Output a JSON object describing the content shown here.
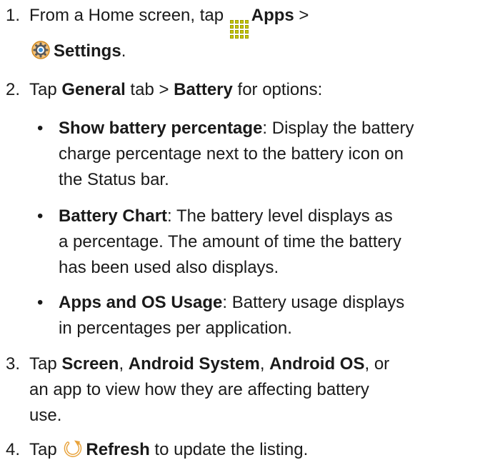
{
  "steps": [
    {
      "number": "1.",
      "line1_pre": "From a Home screen, tap ",
      "apps_label": "Apps",
      "line1_post": " >",
      "settings_label": "Settings",
      "line2_post": "."
    },
    {
      "number": "2.",
      "pre": "Tap ",
      "general_label": "General",
      "mid": " tab > ",
      "battery_label": "Battery",
      "post": " for options:",
      "bullets": [
        {
          "term": "Show battery percentage",
          "line1_rest": ": Display the battery",
          "line2": "charge percentage next to the battery icon on",
          "line3": "the Status bar."
        },
        {
          "term": "Battery Chart",
          "line1_rest": ": The battery level displays as",
          "line2": "a percentage. The amount of time the battery",
          "line3": "has been used also displays."
        },
        {
          "term": "Apps and OS Usage",
          "line1_rest": ": Battery usage displays",
          "line2": "in percentages per application."
        }
      ]
    },
    {
      "number": "3.",
      "pre": "Tap ",
      "screen_label": "Screen",
      "sep1": ", ",
      "android_system_label": "Android System",
      "sep2": ", ",
      "android_os_label": "Android OS",
      "post1": ", or",
      "line2": "an app to view how they are affecting battery",
      "line3": "use."
    },
    {
      "number": "4.",
      "pre": "Tap ",
      "refresh_label": "Refresh",
      "post": " to update the listing."
    }
  ],
  "bullet_glyph": "•",
  "icons": {
    "apps": "apps-grid-icon",
    "settings": "settings-gear-icon",
    "refresh": "refresh-icon"
  },
  "colors": {
    "apps_icon": "#c9c900",
    "settings_icon": "#e8a23a",
    "refresh_icon": "#e8a23a",
    "text": "#1a1a1a"
  }
}
